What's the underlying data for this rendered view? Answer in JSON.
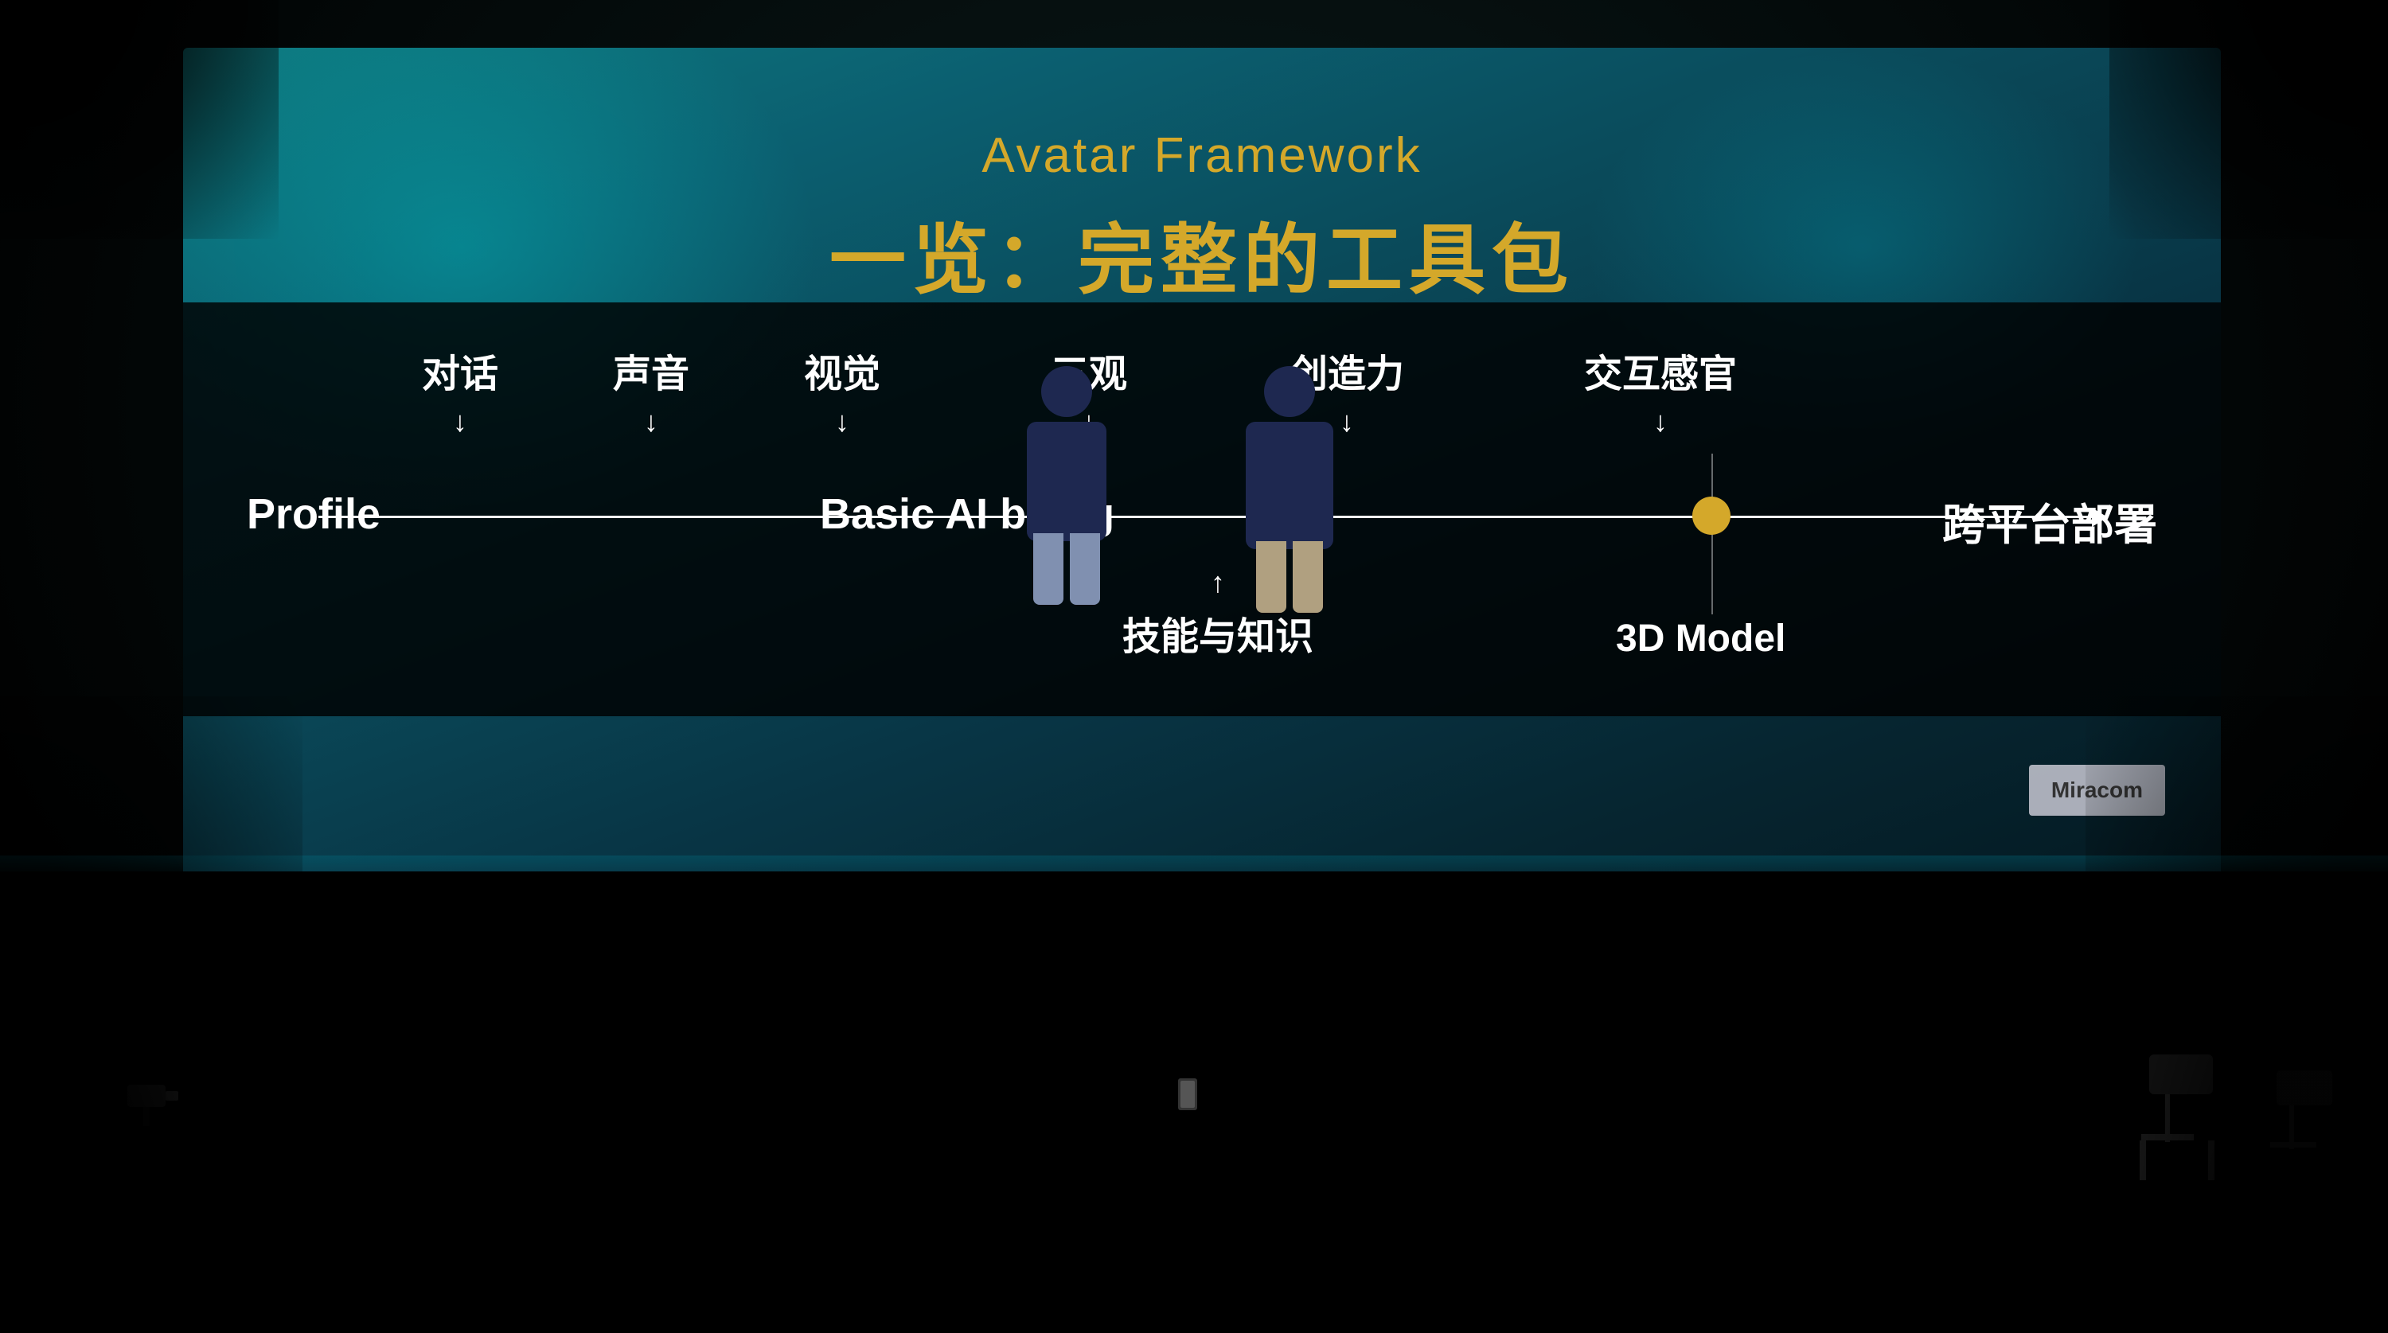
{
  "screen": {
    "title_english": "Avatar Framework",
    "title_chinese": "一览：完整的工具包"
  },
  "diagram": {
    "profile_label": "Profile",
    "basic_ai_label": "Basic AI being",
    "cross_platform_label": "跨平台部署",
    "top_labels": [
      {
        "id": "duihua",
        "text": "对话"
      },
      {
        "id": "shengyin",
        "text": "声音"
      },
      {
        "id": "shijue",
        "text": "视觉"
      },
      {
        "id": "sanguan",
        "text": "三观"
      },
      {
        "id": "chuanglili",
        "text": "创造力"
      },
      {
        "id": "jiaohuganguan",
        "text": "交互感官"
      }
    ],
    "bottom_labels": [
      {
        "id": "jinengzhishi",
        "text": "技能与知识"
      },
      {
        "id": "3dmodel",
        "text": "3D Model"
      }
    ]
  },
  "watermark": {
    "text": "Miracom"
  }
}
